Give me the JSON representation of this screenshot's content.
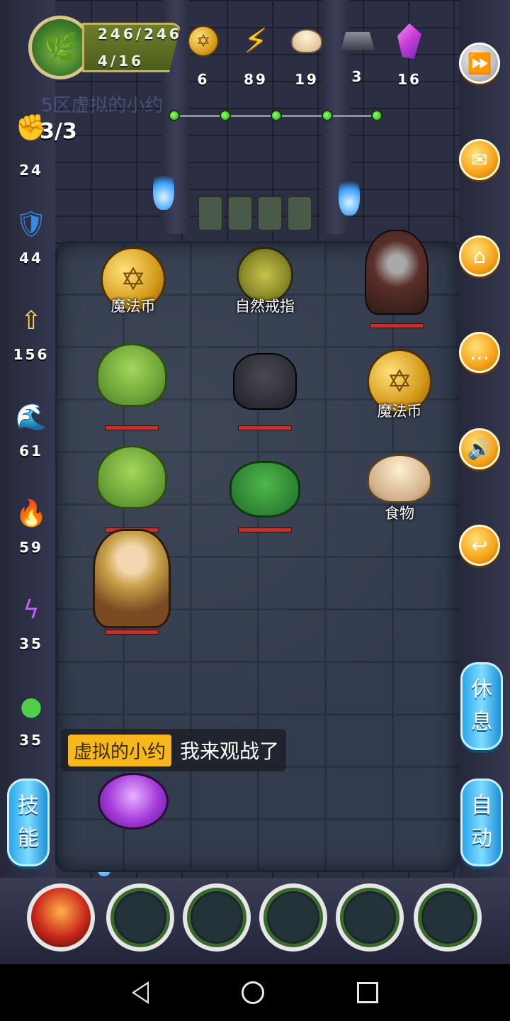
{
  "header": {
    "hp_text": "246/246",
    "level_text": "4/16",
    "floor_label": "5区虚拟的小约",
    "resources": [
      {
        "icon": "magic-coin-icon",
        "value": "6"
      },
      {
        "icon": "energy-bolt-icon",
        "value": "89"
      },
      {
        "icon": "food-bun-icon",
        "value": "19"
      },
      {
        "icon": "iron-ingot-icon",
        "value": "3"
      },
      {
        "icon": "crystal-icon",
        "value": "16"
      }
    ],
    "progress_stages_total": 5
  },
  "left_stats": {
    "fist_count": "3/3",
    "attack": "24",
    "defense": "44",
    "holy": "156",
    "water": "61",
    "fire": "59",
    "lightning": "35",
    "poison": "35"
  },
  "board": {
    "items": [
      {
        "kind": "magic-coin",
        "label": "魔法币"
      },
      {
        "kind": "nature-ring",
        "label": "自然戒指"
      },
      {
        "kind": "magic-coin",
        "label": "魔法币"
      },
      {
        "kind": "food",
        "label": "食物"
      }
    ],
    "monsters": [
      "hooded-skeleton",
      "green-frog",
      "black-cat",
      "green-frog",
      "green-boar"
    ]
  },
  "chat": {
    "name": "虚拟的小约",
    "message": "我来观战了"
  },
  "buttons": {
    "rest": [
      "休",
      "息"
    ],
    "auto": [
      "自",
      "动"
    ],
    "skill": [
      "技",
      "能"
    ]
  },
  "colors": {
    "accent_orange": "#f5a21a",
    "pill_blue": "#2aa6e8",
    "hp_red": "#d12a2a",
    "chat_name_bg": "#f7b81a"
  }
}
